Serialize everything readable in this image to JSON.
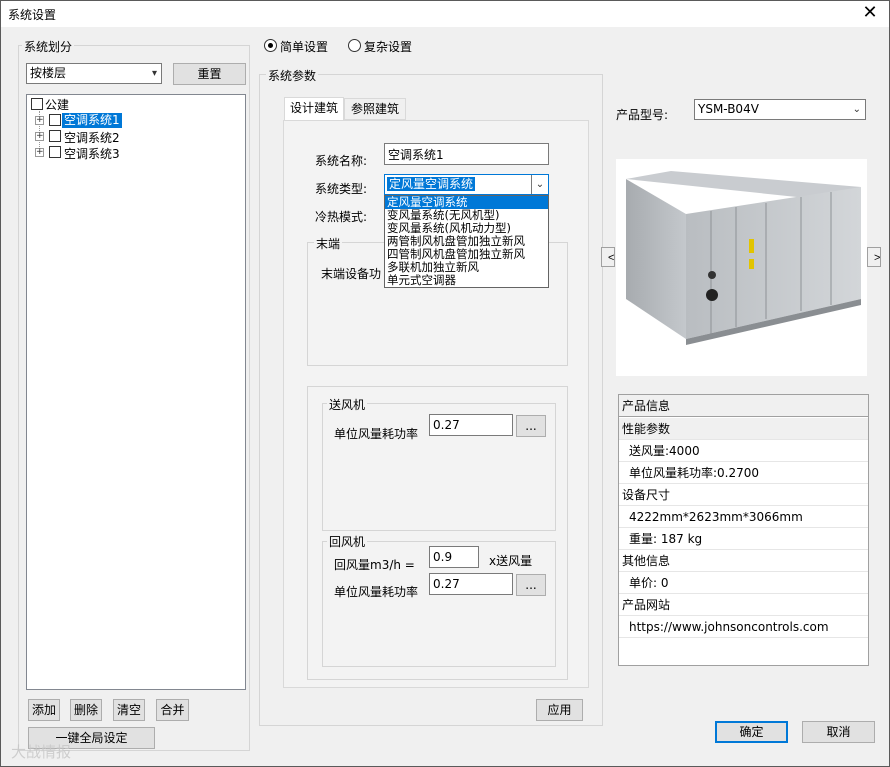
{
  "window": {
    "title": "系统设置",
    "close": "✕"
  },
  "left": {
    "group_label": "系统划分",
    "division_select": "按楼层",
    "reset_button": "重置",
    "tree": {
      "root": "公建",
      "items": [
        "空调系统1",
        "空调系统2",
        "空调系统3"
      ]
    },
    "buttons": {
      "add": "添加",
      "delete": "删除",
      "clear": "清空",
      "merge": "合并",
      "global": "一键全局设定"
    }
  },
  "mode": {
    "simple": "简单设置",
    "complex": "复杂设置",
    "selected": "simple"
  },
  "params": {
    "group_label": "系统参数",
    "tabs": [
      "设计建筑",
      "参照建筑"
    ],
    "name_label": "系统名称:",
    "name_value": "空调系统1",
    "type_label": "系统类型:",
    "type_value": "定风量空调系统",
    "type_options": [
      "定风量空调系统",
      "变风量系统(无风机型)",
      "变风量系统(风机动力型)",
      "两管制风机盘管加独立新风",
      "四管制风机盘管加独立新风",
      "多联机加独立新风",
      "单元式空调器"
    ],
    "mode_label": "冷热模式:",
    "terminal_label": "末端",
    "terminal_power_label": "末端设备功",
    "supply_fan": {
      "label": "送风机",
      "power_label": "单位风量耗功率",
      "power_value": "0.27",
      "more": "..."
    },
    "return_fan": {
      "label": "回风机",
      "ratio_label": "回风量m3/h =",
      "ratio_value": "0.9",
      "ratio_unit": "x送风量",
      "power_label": "单位风量耗功率",
      "power_value": "0.27",
      "more": "..."
    },
    "apply_button": "应用"
  },
  "product": {
    "model_label": "产品型号:",
    "model_value": "YSM-B04V",
    "prev": "<",
    "next": ">",
    "info_header": "产品信息",
    "rows": [
      {
        "type": "cat",
        "text": "性能参数"
      },
      {
        "type": "sub",
        "text": "送风量:4000"
      },
      {
        "type": "sub",
        "text": "单位风量耗功率:0.2700"
      },
      {
        "type": "cat",
        "text": "设备尺寸"
      },
      {
        "type": "sub",
        "text": "4222mm*2623mm*3066mm"
      },
      {
        "type": "sub",
        "text": "重量: 187 kg"
      },
      {
        "type": "cat",
        "text": "其他信息"
      },
      {
        "type": "sub",
        "text": "单价: 0"
      },
      {
        "type": "cat",
        "text": "产品网站"
      },
      {
        "type": "sub",
        "text": "https://www.johnsoncontrols.com"
      }
    ]
  },
  "footer": {
    "ok": "确定",
    "cancel": "取消"
  },
  "watermark": "大战情报"
}
